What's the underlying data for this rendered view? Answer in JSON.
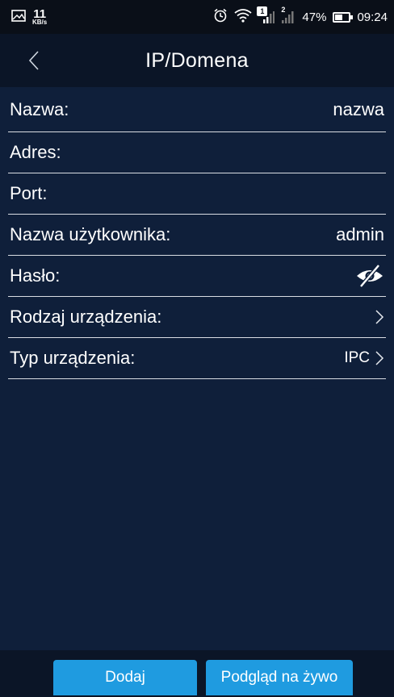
{
  "status_bar": {
    "net_speed": "11",
    "net_unit": "KB/s",
    "sim_badge": "1",
    "sim2_badge": "2",
    "battery": "47%",
    "battery_level": 0.47,
    "time": "09:24"
  },
  "header": {
    "title": "IP/Domena",
    "back_icon": "chevron-left-icon"
  },
  "form": {
    "rows": [
      {
        "label": "Nazwa:",
        "value": "nazwa"
      },
      {
        "label": "Adres:",
        "value": ""
      },
      {
        "label": "Port:",
        "value": ""
      },
      {
        "label": "Nazwa użytkownika:",
        "value": "admin"
      },
      {
        "label": "Hasło:",
        "icon": "eye-slash-icon"
      },
      {
        "label": "Rodzaj urządzenia:",
        "icon": "chevron-right-icon"
      },
      {
        "label": "Typ urządzenia:",
        "value": "IPC",
        "icon": "chevron-right-icon"
      }
    ]
  },
  "buttons": {
    "add": "Dodaj",
    "live_view": "Podgląd na żywo"
  },
  "colors": {
    "background": "#0f1f3a",
    "header": "#0b1527",
    "status_bar": "#0a0f18",
    "button": "#1f9be0",
    "divider": "#d9dde3"
  }
}
